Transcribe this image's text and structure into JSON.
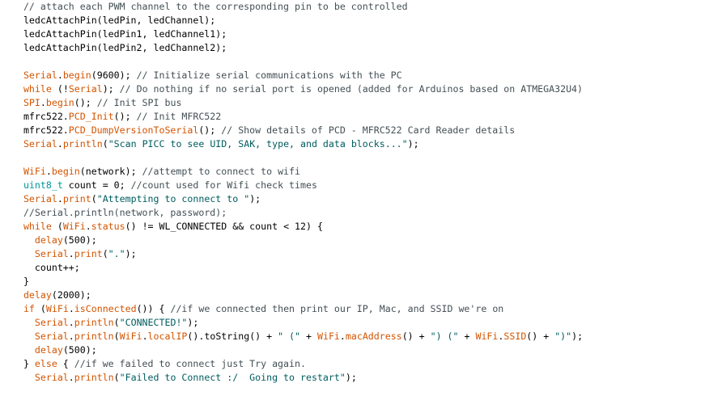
{
  "editor": {
    "lines": [
      [
        {
          "t": "   ",
          "c": "plain"
        },
        {
          "t": "// attach each PWM channel to the corresponding pin to be controlled",
          "c": "comment"
        }
      ],
      [
        {
          "t": "   ledcAttachPin(ledPin, ledChannel);",
          "c": "plain"
        }
      ],
      [
        {
          "t": "   ledcAttachPin(ledPin1, ledChannel1);",
          "c": "plain"
        }
      ],
      [
        {
          "t": "   ledcAttachPin(ledPin2, ledChannel2);",
          "c": "plain"
        }
      ],
      [
        {
          "t": "",
          "c": "plain"
        }
      ],
      [
        {
          "t": "   ",
          "c": "plain"
        },
        {
          "t": "Serial",
          "c": "keyword"
        },
        {
          "t": ".",
          "c": "plain"
        },
        {
          "t": "begin",
          "c": "keyword"
        },
        {
          "t": "(9600); ",
          "c": "plain"
        },
        {
          "t": "// Initialize serial communications with the PC",
          "c": "comment"
        }
      ],
      [
        {
          "t": "   ",
          "c": "plain"
        },
        {
          "t": "while",
          "c": "keyword"
        },
        {
          "t": " (!",
          "c": "plain"
        },
        {
          "t": "Serial",
          "c": "keyword"
        },
        {
          "t": "); ",
          "c": "plain"
        },
        {
          "t": "// Do nothing if no serial port is opened (added for Arduinos based on ATMEGA32U4)",
          "c": "comment"
        }
      ],
      [
        {
          "t": "   ",
          "c": "plain"
        },
        {
          "t": "SPI",
          "c": "keyword"
        },
        {
          "t": ".",
          "c": "plain"
        },
        {
          "t": "begin",
          "c": "keyword"
        },
        {
          "t": "(); ",
          "c": "plain"
        },
        {
          "t": "// Init SPI bus",
          "c": "comment"
        }
      ],
      [
        {
          "t": "   mfrc522.",
          "c": "plain"
        },
        {
          "t": "PCD_Init",
          "c": "keyword"
        },
        {
          "t": "(); ",
          "c": "plain"
        },
        {
          "t": "// Init MFRC522",
          "c": "comment"
        }
      ],
      [
        {
          "t": "   mfrc522.",
          "c": "plain"
        },
        {
          "t": "PCD_DumpVersionToSerial",
          "c": "keyword"
        },
        {
          "t": "(); ",
          "c": "plain"
        },
        {
          "t": "// Show details of PCD - MFRC522 Card Reader details",
          "c": "comment"
        }
      ],
      [
        {
          "t": "   ",
          "c": "plain"
        },
        {
          "t": "Serial",
          "c": "keyword"
        },
        {
          "t": ".",
          "c": "plain"
        },
        {
          "t": "println",
          "c": "keyword"
        },
        {
          "t": "(",
          "c": "plain"
        },
        {
          "t": "\"Scan PICC to see UID, SAK, type, and data blocks...\"",
          "c": "string"
        },
        {
          "t": ");",
          "c": "plain"
        }
      ],
      [
        {
          "t": "",
          "c": "plain"
        }
      ],
      [
        {
          "t": "   ",
          "c": "plain"
        },
        {
          "t": "WiFi",
          "c": "keyword"
        },
        {
          "t": ".",
          "c": "plain"
        },
        {
          "t": "begin",
          "c": "keyword"
        },
        {
          "t": "(network); ",
          "c": "plain"
        },
        {
          "t": "//attempt to connect to wifi",
          "c": "comment"
        }
      ],
      [
        {
          "t": "   ",
          "c": "plain"
        },
        {
          "t": "uint8_t",
          "c": "keyword2"
        },
        {
          "t": " count = 0; ",
          "c": "plain"
        },
        {
          "t": "//count used for Wifi check times",
          "c": "comment"
        }
      ],
      [
        {
          "t": "   ",
          "c": "plain"
        },
        {
          "t": "Serial",
          "c": "keyword"
        },
        {
          "t": ".",
          "c": "plain"
        },
        {
          "t": "print",
          "c": "keyword"
        },
        {
          "t": "(",
          "c": "plain"
        },
        {
          "t": "\"Attempting to connect to \"",
          "c": "string"
        },
        {
          "t": ");",
          "c": "plain"
        }
      ],
      [
        {
          "t": "   ",
          "c": "plain"
        },
        {
          "t": "//Serial.println(network, password);",
          "c": "comment"
        }
      ],
      [
        {
          "t": "   ",
          "c": "plain"
        },
        {
          "t": "while",
          "c": "keyword"
        },
        {
          "t": " (",
          "c": "plain"
        },
        {
          "t": "WiFi",
          "c": "keyword"
        },
        {
          "t": ".",
          "c": "plain"
        },
        {
          "t": "status",
          "c": "keyword"
        },
        {
          "t": "() != WL_CONNECTED && count < 12) {",
          "c": "plain"
        }
      ],
      [
        {
          "t": "     ",
          "c": "plain"
        },
        {
          "t": "delay",
          "c": "keyword"
        },
        {
          "t": "(500);",
          "c": "plain"
        }
      ],
      [
        {
          "t": "     ",
          "c": "plain"
        },
        {
          "t": "Serial",
          "c": "keyword"
        },
        {
          "t": ".",
          "c": "plain"
        },
        {
          "t": "print",
          "c": "keyword"
        },
        {
          "t": "(",
          "c": "plain"
        },
        {
          "t": "\".\"",
          "c": "string"
        },
        {
          "t": ");",
          "c": "plain"
        }
      ],
      [
        {
          "t": "     count++;",
          "c": "plain"
        }
      ],
      [
        {
          "t": "   }",
          "c": "plain"
        }
      ],
      [
        {
          "t": "   ",
          "c": "plain"
        },
        {
          "t": "delay",
          "c": "keyword"
        },
        {
          "t": "(2000);",
          "c": "plain"
        }
      ],
      [
        {
          "t": "   ",
          "c": "plain"
        },
        {
          "t": "if",
          "c": "keyword"
        },
        {
          "t": " (",
          "c": "plain"
        },
        {
          "t": "WiFi",
          "c": "keyword"
        },
        {
          "t": ".",
          "c": "plain"
        },
        {
          "t": "isConnected",
          "c": "keyword"
        },
        {
          "t": "()) { ",
          "c": "plain"
        },
        {
          "t": "//if we connected then print our IP, Mac, and SSID we're on",
          "c": "comment"
        }
      ],
      [
        {
          "t": "     ",
          "c": "plain"
        },
        {
          "t": "Serial",
          "c": "keyword"
        },
        {
          "t": ".",
          "c": "plain"
        },
        {
          "t": "println",
          "c": "keyword"
        },
        {
          "t": "(",
          "c": "plain"
        },
        {
          "t": "\"CONNECTED!\"",
          "c": "string"
        },
        {
          "t": ");",
          "c": "plain"
        }
      ],
      [
        {
          "t": "     ",
          "c": "plain"
        },
        {
          "t": "Serial",
          "c": "keyword"
        },
        {
          "t": ".",
          "c": "plain"
        },
        {
          "t": "println",
          "c": "keyword"
        },
        {
          "t": "(",
          "c": "plain"
        },
        {
          "t": "WiFi",
          "c": "keyword"
        },
        {
          "t": ".",
          "c": "plain"
        },
        {
          "t": "localIP",
          "c": "keyword"
        },
        {
          "t": "().toString() + ",
          "c": "plain"
        },
        {
          "t": "\" (\"",
          "c": "string"
        },
        {
          "t": " + ",
          "c": "plain"
        },
        {
          "t": "WiFi",
          "c": "keyword"
        },
        {
          "t": ".",
          "c": "plain"
        },
        {
          "t": "macAddress",
          "c": "keyword"
        },
        {
          "t": "() + ",
          "c": "plain"
        },
        {
          "t": "\") (\"",
          "c": "string"
        },
        {
          "t": " + ",
          "c": "plain"
        },
        {
          "t": "WiFi",
          "c": "keyword"
        },
        {
          "t": ".",
          "c": "plain"
        },
        {
          "t": "SSID",
          "c": "keyword"
        },
        {
          "t": "() + ",
          "c": "plain"
        },
        {
          "t": "\")\"",
          "c": "string"
        },
        {
          "t": ");",
          "c": "plain"
        }
      ],
      [
        {
          "t": "     ",
          "c": "plain"
        },
        {
          "t": "delay",
          "c": "keyword"
        },
        {
          "t": "(500);",
          "c": "plain"
        }
      ],
      [
        {
          "t": "   } ",
          "c": "plain"
        },
        {
          "t": "else",
          "c": "keyword"
        },
        {
          "t": " { ",
          "c": "plain"
        },
        {
          "t": "//if we failed to connect just Try again.",
          "c": "comment"
        }
      ],
      [
        {
          "t": "     ",
          "c": "plain"
        },
        {
          "t": "Serial",
          "c": "keyword"
        },
        {
          "t": ".",
          "c": "plain"
        },
        {
          "t": "println",
          "c": "keyword"
        },
        {
          "t": "(",
          "c": "plain"
        },
        {
          "t": "\"Failed to Connect :/  Going to restart\"",
          "c": "string"
        },
        {
          "t": ");",
          "c": "plain"
        }
      ]
    ]
  }
}
